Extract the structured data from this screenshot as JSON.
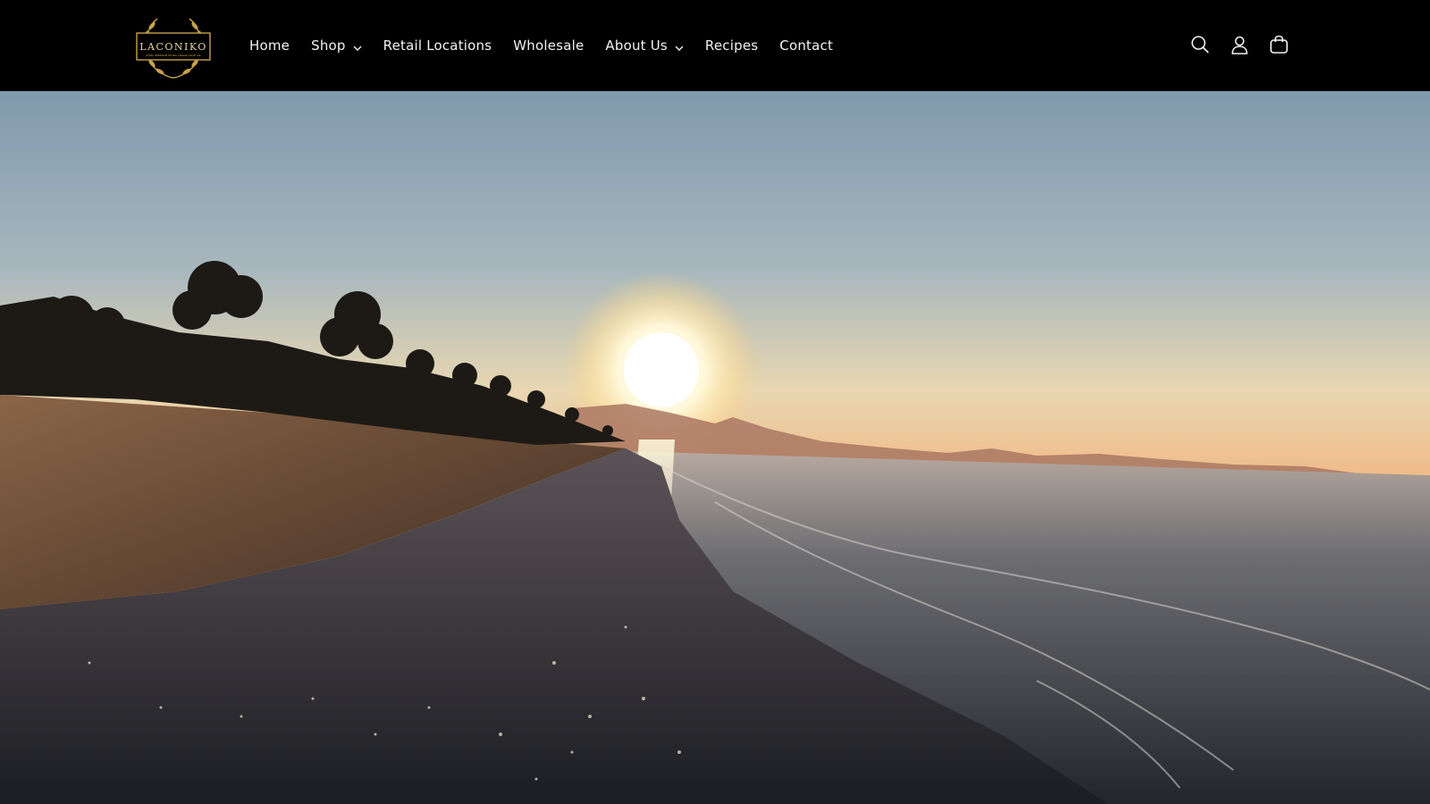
{
  "brand": {
    "logo_text": "LACONIKO",
    "logo_tagline": "ULTRA PREMIUM EXTRA VIRGIN OLIVE OIL",
    "logo_color": "#c9a24a"
  },
  "nav": {
    "items": [
      {
        "label": "Home",
        "has_dropdown": false
      },
      {
        "label": "Shop",
        "has_dropdown": true
      },
      {
        "label": "Retail Locations",
        "has_dropdown": false
      },
      {
        "label": "Wholesale",
        "has_dropdown": false
      },
      {
        "label": "About Us",
        "has_dropdown": true
      },
      {
        "label": "Recipes",
        "has_dropdown": false
      },
      {
        "label": "Contact",
        "has_dropdown": false
      }
    ]
  },
  "header_icons": [
    "search-icon",
    "account-icon",
    "cart-icon"
  ],
  "hero": {
    "image": "sunset-over-beach-and-sea",
    "sky_top_color": "#7f99ad",
    "sky_horizon_color": "#f2b27a"
  }
}
